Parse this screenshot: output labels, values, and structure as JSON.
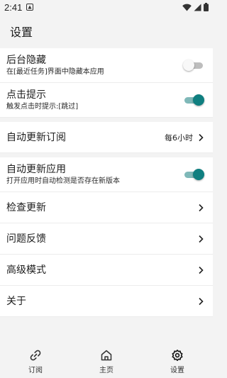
{
  "status_bar": {
    "time": "2:41"
  },
  "app_bar": {
    "title": "设置"
  },
  "settings": {
    "hide_background": {
      "title": "后台隐藏",
      "subtitle": "在[最近任务]界面中隐藏本应用",
      "enabled": false
    },
    "click_hint": {
      "title": "点击提示",
      "subtitle": "触发点击时提示:[跳过]",
      "enabled": true
    },
    "auto_update_subscription": {
      "title": "自动更新订阅",
      "value": "每6小时"
    },
    "auto_update_app": {
      "title": "自动更新应用",
      "subtitle": "打开应用时自动检测是否存在新版本",
      "enabled": true
    },
    "check_update": {
      "title": "检查更新"
    },
    "feedback": {
      "title": "问题反馈"
    },
    "advanced_mode": {
      "title": "高级模式"
    },
    "about": {
      "title": "关于"
    }
  },
  "bottom_nav": {
    "items": [
      {
        "label": "订阅",
        "icon": "link-icon"
      },
      {
        "label": "主页",
        "icon": "home-icon"
      },
      {
        "label": "设置",
        "icon": "gear-icon",
        "active": true
      }
    ]
  },
  "colors": {
    "accent": "#0f7f80",
    "accent_track": "#7fb8b8",
    "background": "#f3f3f3"
  }
}
